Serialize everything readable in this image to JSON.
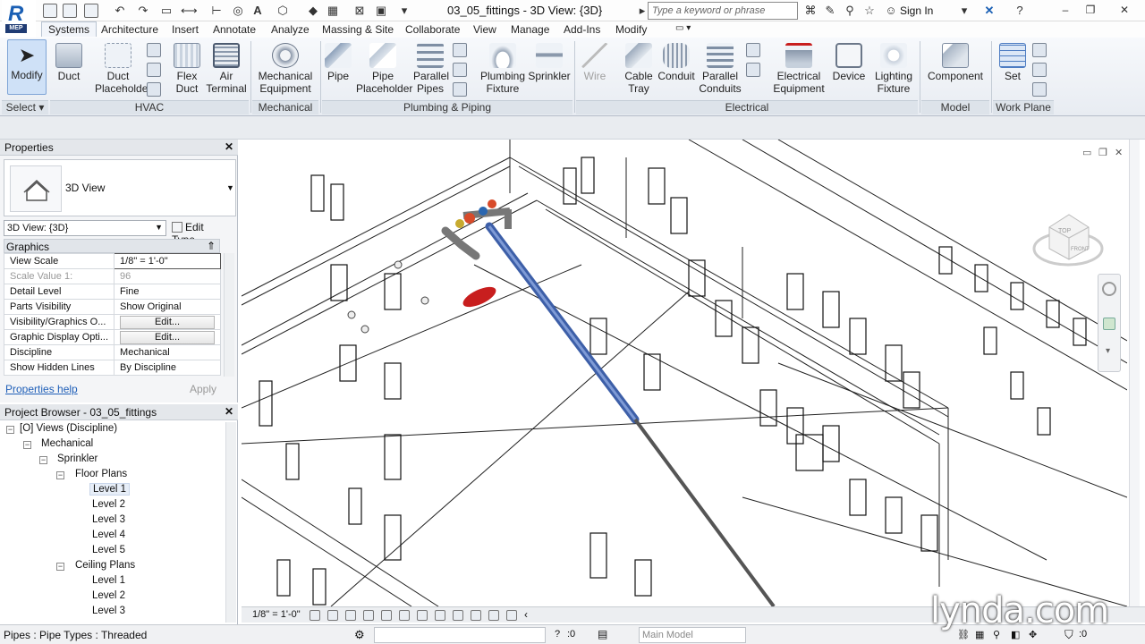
{
  "app": {
    "badge": "MEP",
    "title": "03_05_fittings - 3D View: {3D}",
    "search_placeholder": "Type a keyword or phrase",
    "sign_in": "Sign In"
  },
  "tabs": [
    "Systems",
    "Architecture",
    "Insert",
    "Annotate",
    "Analyze",
    "Massing & Site",
    "Collaborate",
    "View",
    "Manage",
    "Add-Ins",
    "Modify"
  ],
  "ribbon": {
    "buttons": {
      "modify": "Modify",
      "duct": "Duct",
      "duct_placeholder_1": "Duct",
      "duct_placeholder_2": "Placeholder",
      "flex_duct_1": "Flex",
      "flex_duct_2": "Duct",
      "air_terminal_1": "Air",
      "air_terminal_2": "Terminal",
      "mech_equipment_1": "Mechanical",
      "mech_equipment_2": "Equipment",
      "pipe": "Pipe",
      "pipe_placeholder_1": "Pipe",
      "pipe_placeholder_2": "Placeholder",
      "parallel_pipes_1": "Parallel",
      "parallel_pipes_2": "Pipes",
      "plumbing_fixture_1": "Plumbing",
      "plumbing_fixture_2": "Fixture",
      "sprinkler": "Sprinkler",
      "wire": "Wire",
      "cable_tray_1": "Cable",
      "cable_tray_2": "Tray",
      "conduit": "Conduit",
      "parallel_conduits_1": "Parallel",
      "parallel_conduits_2": "Conduits",
      "electrical_equipment_1": "Electrical",
      "electrical_equipment_2": "Equipment",
      "device": "Device",
      "lighting_fixture_1": "Lighting",
      "lighting_fixture_2": "Fixture",
      "component": "Component",
      "set": "Set"
    },
    "panels": {
      "select": "Select",
      "hvac": "HVAC",
      "mechanical": "Mechanical",
      "plumbing_piping": "Plumbing & Piping",
      "electrical": "Electrical",
      "model": "Model",
      "work_plane": "Work Plane"
    }
  },
  "properties": {
    "header": "Properties",
    "type_name": "3D View",
    "instance_selector": "3D View: {3D}",
    "edit_type": "Edit Type",
    "group": "Graphics",
    "rows": [
      {
        "key": "View Scale",
        "value": "1/8\" = 1'-0\""
      },
      {
        "key": "Scale Value    1:",
        "value": "96"
      },
      {
        "key": "Detail Level",
        "value": "Fine"
      },
      {
        "key": "Parts Visibility",
        "value": "Show Original"
      },
      {
        "key": "Visibility/Graphics O...",
        "value": "Edit..."
      },
      {
        "key": "Graphic Display Opti...",
        "value": "Edit..."
      },
      {
        "key": "Discipline",
        "value": "Mechanical"
      },
      {
        "key": "Show Hidden Lines",
        "value": "By Discipline"
      }
    ],
    "help": "Properties help",
    "apply": "Apply"
  },
  "browser": {
    "header": "Project Browser - 03_05_fittings",
    "root": "Views (Discipline)",
    "discipline": "Mechanical",
    "subdiscipline": "Sprinkler",
    "floor_plans": "Floor Plans",
    "floor_levels": [
      "Level 1",
      "Level 2",
      "Level 3",
      "Level 4",
      "Level 5"
    ],
    "ceiling_plans": "Ceiling Plans",
    "ceiling_levels": [
      "Level 1",
      "Level 2",
      "Level 3"
    ]
  },
  "view_control": {
    "scale": "1/8\" = 1'-0\""
  },
  "status": {
    "text": "Pipes : Pipe Types : Threaded",
    "worksets_count": ":0",
    "design_option": "Main Model",
    "filter_count": ":0"
  },
  "watermark": "lynda.com",
  "colors": {
    "pipe_blue": "#3d5fa8",
    "equipment_red": "#c81e1e",
    "accent": "#1a5fb4"
  }
}
